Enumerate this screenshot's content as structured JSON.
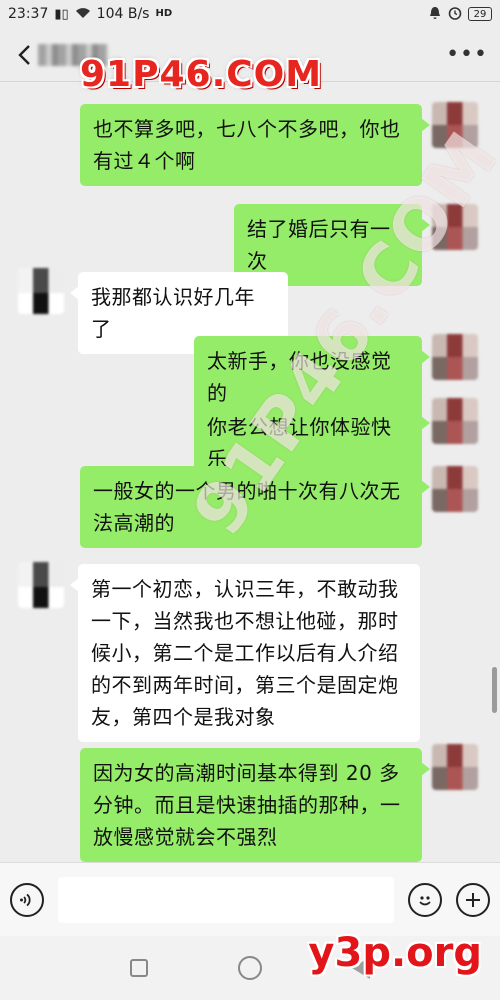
{
  "status_bar": {
    "time": "23:37",
    "network_speed": "104 B/s",
    "battery": "29",
    "icons": [
      "sim-signal-icon",
      "wifi-icon",
      "hd-icon",
      "bell-icon",
      "alarm-icon",
      "battery-icon"
    ]
  },
  "header": {
    "contact_name": "",
    "watermark": "91P46.COM"
  },
  "messages": [
    {
      "from": "me",
      "text": "也不算多吧，七八个不多吧，你也有过４个啊"
    },
    {
      "from": "me",
      "text": "结了婚后只有一次"
    },
    {
      "from": "them",
      "text": "我那都认识好几年了"
    },
    {
      "from": "me",
      "text": "太新手，你也没感觉的"
    },
    {
      "from": "me",
      "text": "你老公想让你体验快乐"
    },
    {
      "from": "me",
      "text": "一般女的一个男的啪十次有八次无法高潮的"
    },
    {
      "from": "them",
      "text": "第一个初恋，认识三年，不敢动我一下，当然我也不想让他碰，那时候小，第二个是工作以后有人介绍的不到两年时间，第三个是固定炮友，第四个是我对象"
    },
    {
      "from": "me",
      "text": "因为女的高潮时间基本得到 20 多分钟。而且是快速抽插的那种，一放慢感觉就会不强烈"
    }
  ],
  "watermarks": {
    "diagonal": "91P46.COM",
    "bottom": "y3p.org"
  },
  "input_bar": {
    "placeholder": "",
    "voice_icon": "voice-icon",
    "emoji_icon": "emoji-icon",
    "plus_icon": "plus-icon"
  },
  "colors": {
    "sent_bubble": "#95ec69",
    "recv_bubble": "#ffffff",
    "background": "#ededed"
  }
}
